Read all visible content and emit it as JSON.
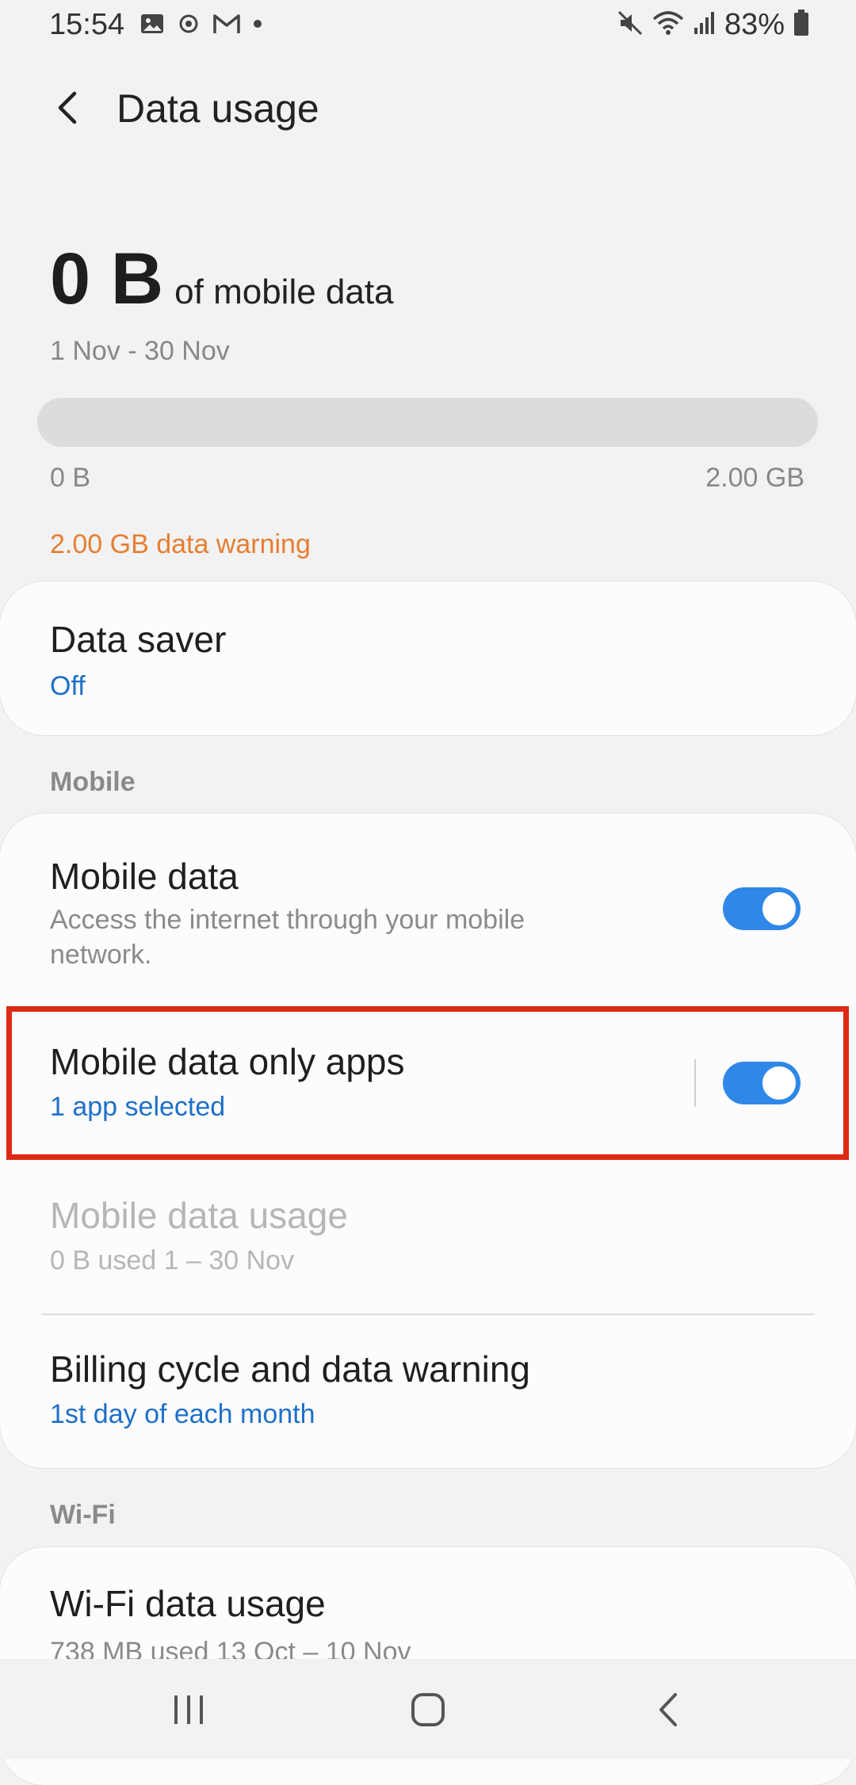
{
  "status_bar": {
    "time": "15:54",
    "battery": "83%",
    "icons": [
      "gallery-icon",
      "sync-icon",
      "gmail-icon",
      "dot-icon",
      "mute-icon",
      "wifi-icon",
      "signal-icon",
      "battery-icon"
    ]
  },
  "header": {
    "title": "Data usage",
    "back_icon": "chevron-left-icon"
  },
  "summary": {
    "amount": "0 B",
    "caption": "of mobile data",
    "period": "1 Nov - 30 Nov",
    "usage_fraction": 0,
    "range_min": "0 B",
    "range_max": "2.00 GB",
    "warning": "2.00 GB data warning"
  },
  "data_saver": {
    "title": "Data saver",
    "status": "Off"
  },
  "mobile_section": {
    "header": "Mobile",
    "mobile_data": {
      "title": "Mobile data",
      "subtitle": "Access the internet through your mobile network.",
      "enabled": true
    },
    "mobile_data_only_apps": {
      "title": "Mobile data only apps",
      "subtitle": "1 app selected",
      "enabled": true
    },
    "mobile_data_usage": {
      "title": "Mobile data usage",
      "subtitle": "0 B used 1 – 30 Nov"
    },
    "billing_cycle": {
      "title": "Billing cycle and data warning",
      "subtitle": "1st day of each month"
    }
  },
  "wifi_section": {
    "header": "Wi-Fi",
    "wifi_data_usage": {
      "title": "Wi-Fi data usage",
      "subtitle": "738 MB used 13 Oct – 10 Nov"
    }
  },
  "colors": {
    "accent": "#2f87e8",
    "link_blue": "#1f6fc9",
    "warning_orange": "#e67e33",
    "highlight_red": "#dd2a14"
  },
  "nav_bar": {
    "icons": [
      "recents-icon",
      "home-icon",
      "back-icon"
    ]
  }
}
